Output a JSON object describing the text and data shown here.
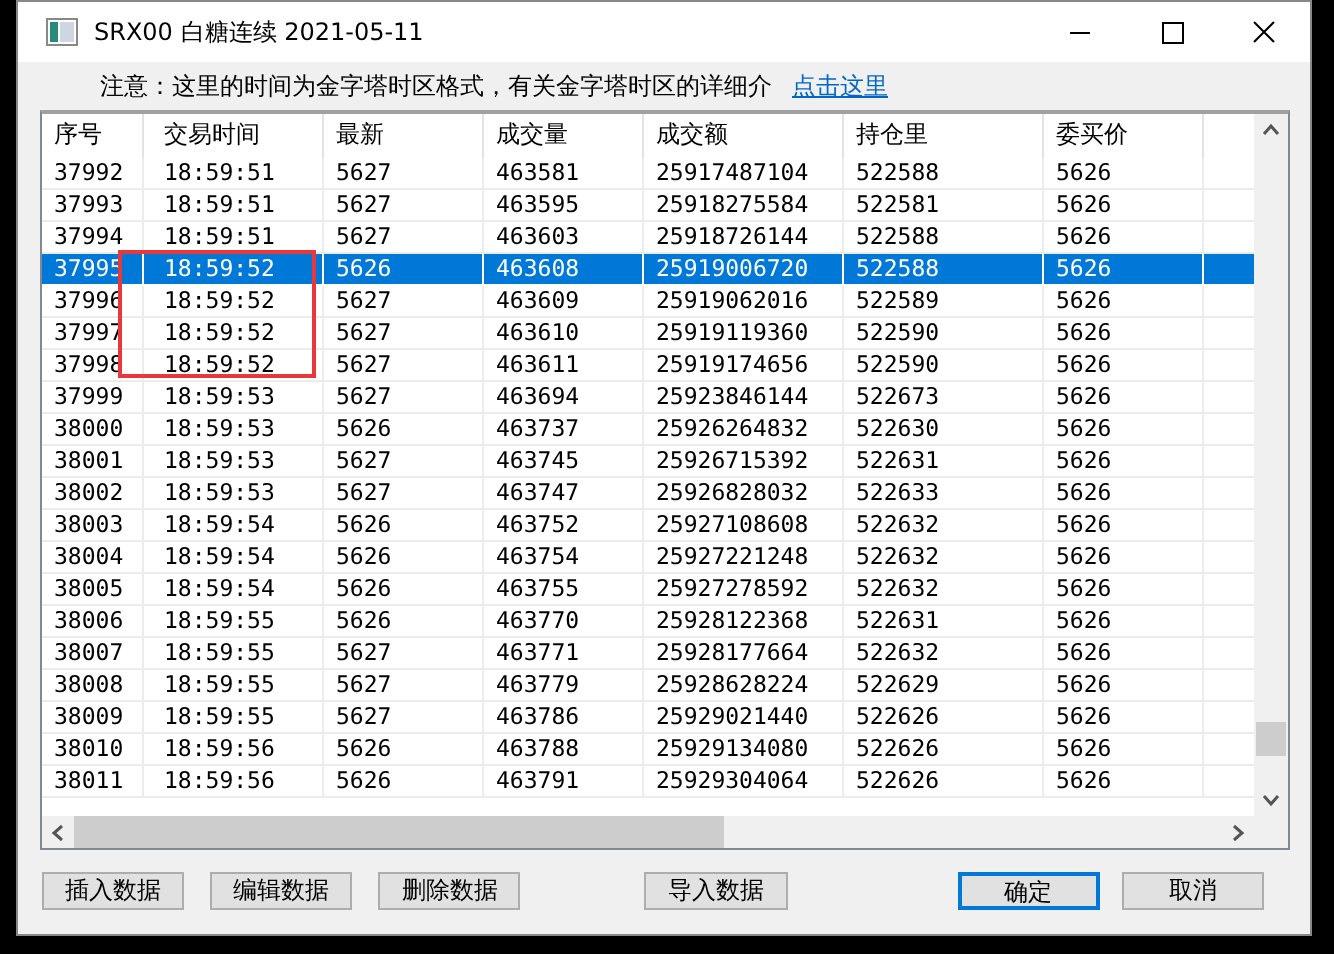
{
  "window": {
    "title": "SRX00 白糖连续 2021-05-11"
  },
  "notice": {
    "text": "注意：这里的时间为金字塔时区格式，有关金字塔时区的详细介",
    "link": "点击这里"
  },
  "table": {
    "columns": [
      "序号",
      "交易时间",
      "最新",
      "成交量",
      "成交额",
      "持仓里",
      "委买价"
    ],
    "rows": [
      {
        "cells": [
          "37992",
          "18:59:51",
          "5627",
          "463581",
          "25917487104",
          "522588",
          "5626"
        ],
        "selected": false
      },
      {
        "cells": [
          "37993",
          "18:59:51",
          "5627",
          "463595",
          "25918275584",
          "522581",
          "5626"
        ],
        "selected": false
      },
      {
        "cells": [
          "37994",
          "18:59:51",
          "5627",
          "463603",
          "25918726144",
          "522588",
          "5626"
        ],
        "selected": false
      },
      {
        "cells": [
          "37995",
          "18:59:52",
          "5626",
          "463608",
          "25919006720",
          "522588",
          "5626"
        ],
        "selected": true
      },
      {
        "cells": [
          "37996",
          "18:59:52",
          "5627",
          "463609",
          "25919062016",
          "522589",
          "5626"
        ],
        "selected": false
      },
      {
        "cells": [
          "37997",
          "18:59:52",
          "5627",
          "463610",
          "25919119360",
          "522590",
          "5626"
        ],
        "selected": false
      },
      {
        "cells": [
          "37998",
          "18:59:52",
          "5627",
          "463611",
          "25919174656",
          "522590",
          "5626"
        ],
        "selected": false
      },
      {
        "cells": [
          "37999",
          "18:59:53",
          "5627",
          "463694",
          "25923846144",
          "522673",
          "5626"
        ],
        "selected": false
      },
      {
        "cells": [
          "38000",
          "18:59:53",
          "5626",
          "463737",
          "25926264832",
          "522630",
          "5626"
        ],
        "selected": false
      },
      {
        "cells": [
          "38001",
          "18:59:53",
          "5627",
          "463745",
          "25926715392",
          "522631",
          "5626"
        ],
        "selected": false
      },
      {
        "cells": [
          "38002",
          "18:59:53",
          "5627",
          "463747",
          "25926828032",
          "522633",
          "5626"
        ],
        "selected": false
      },
      {
        "cells": [
          "38003",
          "18:59:54",
          "5626",
          "463752",
          "25927108608",
          "522632",
          "5626"
        ],
        "selected": false
      },
      {
        "cells": [
          "38004",
          "18:59:54",
          "5626",
          "463754",
          "25927221248",
          "522632",
          "5626"
        ],
        "selected": false
      },
      {
        "cells": [
          "38005",
          "18:59:54",
          "5626",
          "463755",
          "25927278592",
          "522632",
          "5626"
        ],
        "selected": false
      },
      {
        "cells": [
          "38006",
          "18:59:55",
          "5626",
          "463770",
          "25928122368",
          "522631",
          "5626"
        ],
        "selected": false
      },
      {
        "cells": [
          "38007",
          "18:59:55",
          "5627",
          "463771",
          "25928177664",
          "522632",
          "5626"
        ],
        "selected": false
      },
      {
        "cells": [
          "38008",
          "18:59:55",
          "5627",
          "463779",
          "25928628224",
          "522629",
          "5626"
        ],
        "selected": false
      },
      {
        "cells": [
          "38009",
          "18:59:55",
          "5627",
          "463786",
          "25929021440",
          "522626",
          "5626"
        ],
        "selected": false
      },
      {
        "cells": [
          "38010",
          "18:59:56",
          "5626",
          "463788",
          "25929134080",
          "522626",
          "5626"
        ],
        "selected": false
      },
      {
        "cells": [
          "38011",
          "18:59:56",
          "5626",
          "463791",
          "25929304064",
          "522626",
          "5626"
        ],
        "selected": false
      }
    ]
  },
  "buttons": [
    {
      "label": "插入数据",
      "default": false
    },
    {
      "label": "编辑数据",
      "default": false
    },
    {
      "label": "删除数据",
      "default": false
    },
    {
      "label": "导入数据",
      "default": false
    },
    {
      "label": "确定",
      "default": true
    },
    {
      "label": "取消",
      "default": false
    }
  ]
}
